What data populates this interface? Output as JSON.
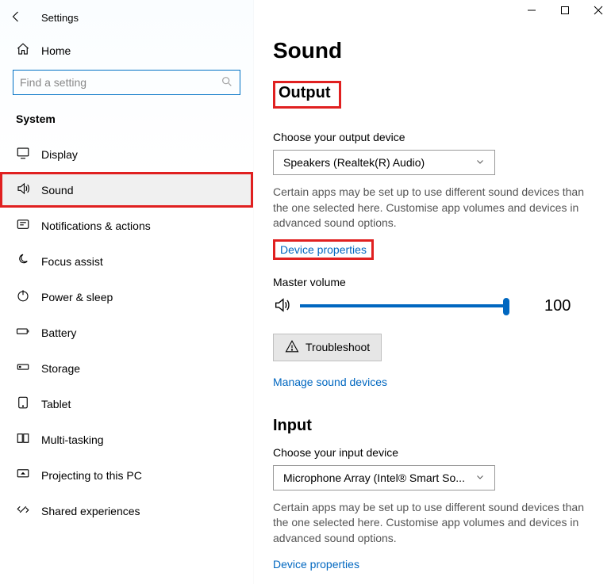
{
  "app_title": "Settings",
  "home_label": "Home",
  "search_placeholder": "Find a setting",
  "section_label": "System",
  "sidebar": {
    "items": [
      {
        "label": "Display"
      },
      {
        "label": "Sound"
      },
      {
        "label": "Notifications & actions"
      },
      {
        "label": "Focus assist"
      },
      {
        "label": "Power & sleep"
      },
      {
        "label": "Battery"
      },
      {
        "label": "Storage"
      },
      {
        "label": "Tablet"
      },
      {
        "label": "Multi-tasking"
      },
      {
        "label": "Projecting to this PC"
      },
      {
        "label": "Shared experiences"
      }
    ]
  },
  "page_title": "Sound",
  "output": {
    "heading": "Output",
    "choose_label": "Choose your output device",
    "device": "Speakers (Realtek(R) Audio)",
    "hint": "Certain apps may be set up to use different sound devices than the one selected here. Customise app volumes and devices in advanced sound options.",
    "device_props": "Device properties",
    "master_label": "Master volume",
    "volume": "100",
    "troubleshoot": "Troubleshoot",
    "manage": "Manage sound devices"
  },
  "input": {
    "heading": "Input",
    "choose_label": "Choose your input device",
    "device": "Microphone Array (Intel® Smart So...",
    "hint": "Certain apps may be set up to use different sound devices than the one selected here. Customise app volumes and devices in advanced sound options.",
    "device_props": "Device properties"
  }
}
